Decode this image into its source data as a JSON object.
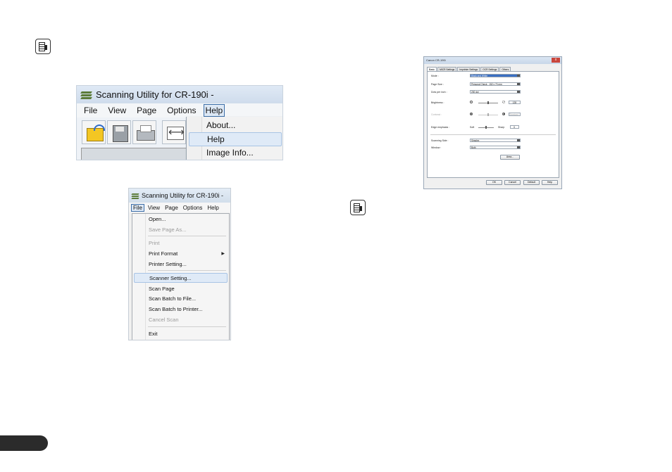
{
  "screenshot_file_menu_help": {
    "window_title": "Scanning Utility for CR-190i -",
    "menu": [
      "File",
      "View",
      "Page",
      "Options",
      "Help"
    ],
    "help_menu_items": [
      "About...",
      "Help",
      "Image Info..."
    ]
  },
  "screenshot_file_menu": {
    "window_title": "Scanning Utility for CR-190i -",
    "menu": [
      "File",
      "View",
      "Page",
      "Options",
      "Help"
    ],
    "file_menu_items": [
      {
        "label": "Open...",
        "enabled": true
      },
      {
        "label": "Save Page As...",
        "enabled": false
      },
      {
        "label": "Print",
        "enabled": false
      },
      {
        "label": "Print Format",
        "enabled": true
      },
      {
        "label": "Printer Setting...",
        "enabled": true
      },
      {
        "label": "Scanner Setting...",
        "enabled": true,
        "highlighted": true
      },
      {
        "label": "Scan Page",
        "enabled": true
      },
      {
        "label": "Scan Batch to File...",
        "enabled": true
      },
      {
        "label": "Scan Batch to Printer...",
        "enabled": true
      },
      {
        "label": "Cancel Scan",
        "enabled": false
      },
      {
        "label": "Exit",
        "enabled": true
      }
    ]
  },
  "screenshot_scanner_dialog": {
    "title": "Canon CR-190i",
    "close": "x",
    "tabs": [
      "Basic",
      "MICR Settings",
      "Imprinter Settings",
      "OCR Settings",
      "Others"
    ],
    "mode_label": "Mode :",
    "mode_value": "Black and White",
    "page_size_label": "Page Size :",
    "page_size_value": "Personal Check - 152 x 70 mm",
    "dpi_label": "Dots per inch :",
    "dpi_value": "200 dpi",
    "brightness_label": "Brightness :",
    "brightness_value": "128",
    "contrast_label": "Contrast :",
    "contrast_value": "Standard",
    "edge_label": "Edge emphasis :",
    "edge_soft": "Soft",
    "edge_sharp": "Sharp",
    "edge_value": "0",
    "scanning_side_label": "Scanning Side :",
    "scanning_side_value": "Simplex",
    "window_label": "Window :",
    "window_value": "Both",
    "area_button": "Area...",
    "buttons": [
      "OK",
      "Cancel",
      "Default",
      "Help"
    ]
  },
  "icons": [
    "note-icon",
    "app-icon",
    "open-folder-icon",
    "save-icon",
    "print-icon",
    "fit-width-icon"
  ],
  "colors": {
    "highlight": "#dfeaf7",
    "menu_active_border": "#3c6ea8",
    "page_tab": "#2b2b2b"
  }
}
